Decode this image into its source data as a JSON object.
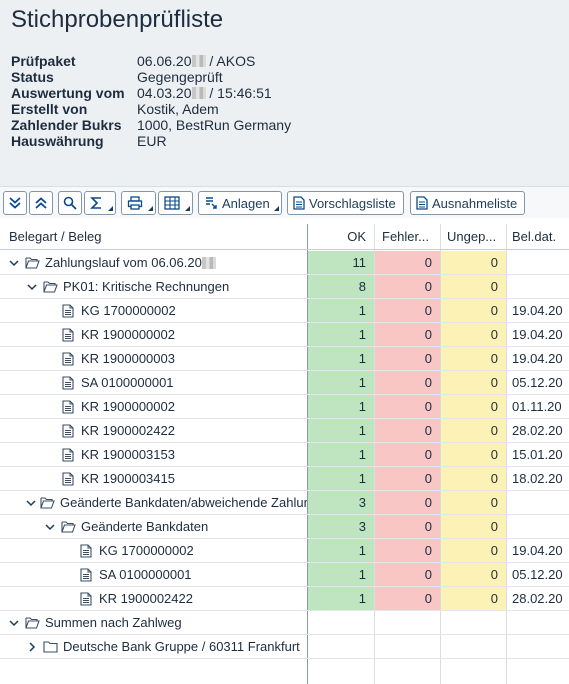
{
  "page": {
    "title": "Stichprobenprüfliste"
  },
  "info": [
    {
      "label": "Prüfpaket",
      "value_pre": "06.06.20",
      "blurred": true,
      "value_post": " / AKOS"
    },
    {
      "label": "Status",
      "value_pre": "Gegengeprüft",
      "blurred": false,
      "value_post": ""
    },
    {
      "label": "Auswertung vom",
      "value_pre": "04.03.20",
      "blurred": true,
      "value_post": " / 15:46:51"
    },
    {
      "label": "Erstellt von",
      "value_pre": "Kostik, Adem",
      "blurred": false,
      "value_post": ""
    },
    {
      "label": "Zahlender Bukrs",
      "value_pre": "1000, BestRun Germany",
      "blurred": false,
      "value_post": ""
    },
    {
      "label": "Hauswährung",
      "value_pre": "EUR",
      "blurred": false,
      "value_post": ""
    }
  ],
  "toolbar": {
    "attachments": "Anlagen",
    "proposal_list": "Vorschlagsliste",
    "exception_list": "Ausnahmeliste"
  },
  "columns": {
    "doc_type": "Belegart / Beleg",
    "ok": "OK",
    "errors": "Fehler...",
    "unchecked": "Ungep...",
    "doc_date": "Bel.dat."
  },
  "colors": {
    "ok": "#bfe4c0",
    "error": "#f9c6c6",
    "unchecked": "#fdf2b5"
  },
  "rows": [
    {
      "label": "Zahlungslauf vom 06.06.20",
      "blurred": true,
      "level": 0,
      "chevron": "down",
      "icon": "folder-open",
      "ok": "11",
      "errors": "0",
      "unchecked": "0",
      "date": ""
    },
    {
      "label": "PK01: Kritische Rechnungen",
      "blurred": false,
      "level": 1,
      "chevron": "down",
      "icon": "folder-open",
      "ok": "8",
      "errors": "0",
      "unchecked": "0",
      "date": ""
    },
    {
      "label": "KG 1700000002",
      "blurred": false,
      "level": 2,
      "chevron": "",
      "icon": "document",
      "ok": "1",
      "errors": "0",
      "unchecked": "0",
      "date": "19.04.20"
    },
    {
      "label": "KR 1900000002",
      "blurred": false,
      "level": 2,
      "chevron": "",
      "icon": "document",
      "ok": "1",
      "errors": "0",
      "unchecked": "0",
      "date": "19.04.20"
    },
    {
      "label": "KR 1900000003",
      "blurred": false,
      "level": 2,
      "chevron": "",
      "icon": "document",
      "ok": "1",
      "errors": "0",
      "unchecked": "0",
      "date": "19.04.20"
    },
    {
      "label": "SA 0100000001",
      "blurred": false,
      "level": 2,
      "chevron": "",
      "icon": "document",
      "ok": "1",
      "errors": "0",
      "unchecked": "0",
      "date": "05.12.20"
    },
    {
      "label": "KR 1900000002",
      "blurred": false,
      "level": 2,
      "chevron": "",
      "icon": "document",
      "ok": "1",
      "errors": "0",
      "unchecked": "0",
      "date": "01.11.20"
    },
    {
      "label": "KR 1900002422",
      "blurred": false,
      "level": 2,
      "chevron": "",
      "icon": "document",
      "ok": "1",
      "errors": "0",
      "unchecked": "0",
      "date": "28.02.20"
    },
    {
      "label": "KR 1900003153",
      "blurred": false,
      "level": 2,
      "chevron": "",
      "icon": "document",
      "ok": "1",
      "errors": "0",
      "unchecked": "0",
      "date": "15.01.20"
    },
    {
      "label": "KR 1900003415",
      "blurred": false,
      "level": 2,
      "chevron": "",
      "icon": "document",
      "ok": "1",
      "errors": "0",
      "unchecked": "0",
      "date": "18.02.20"
    },
    {
      "label": "Geänderte Bankdaten/abweichende Zahlungsempfänger",
      "blurred": false,
      "level": 1,
      "chevron": "down",
      "icon": "folder-open",
      "ok": "3",
      "errors": "0",
      "unchecked": "0",
      "date": ""
    },
    {
      "label": "Geänderte Bankdaten",
      "blurred": false,
      "level": 2,
      "chevron": "down",
      "icon": "folder-open",
      "ok": "3",
      "errors": "0",
      "unchecked": "0",
      "date": ""
    },
    {
      "label": "KG 1700000002",
      "blurred": false,
      "level": 3,
      "chevron": "",
      "icon": "document",
      "ok": "1",
      "errors": "0",
      "unchecked": "0",
      "date": "19.04.20"
    },
    {
      "label": "SA 0100000001",
      "blurred": false,
      "level": 3,
      "chevron": "",
      "icon": "document",
      "ok": "1",
      "errors": "0",
      "unchecked": "0",
      "date": "05.12.20"
    },
    {
      "label": "KR 1900002422",
      "blurred": false,
      "level": 3,
      "chevron": "",
      "icon": "document",
      "ok": "1",
      "errors": "0",
      "unchecked": "0",
      "date": "28.02.20"
    },
    {
      "label": "Summen nach Zahlweg",
      "blurred": false,
      "level": 0,
      "chevron": "down",
      "icon": "folder-open",
      "ok": "",
      "errors": "",
      "unchecked": "",
      "date": ""
    },
    {
      "label": "Deutsche Bank Gruppe / 60311 Frankfurt",
      "blurred": false,
      "level": 1,
      "chevron": "right",
      "icon": "folder-closed",
      "ok": "",
      "errors": "",
      "unchecked": "",
      "date": ""
    }
  ]
}
